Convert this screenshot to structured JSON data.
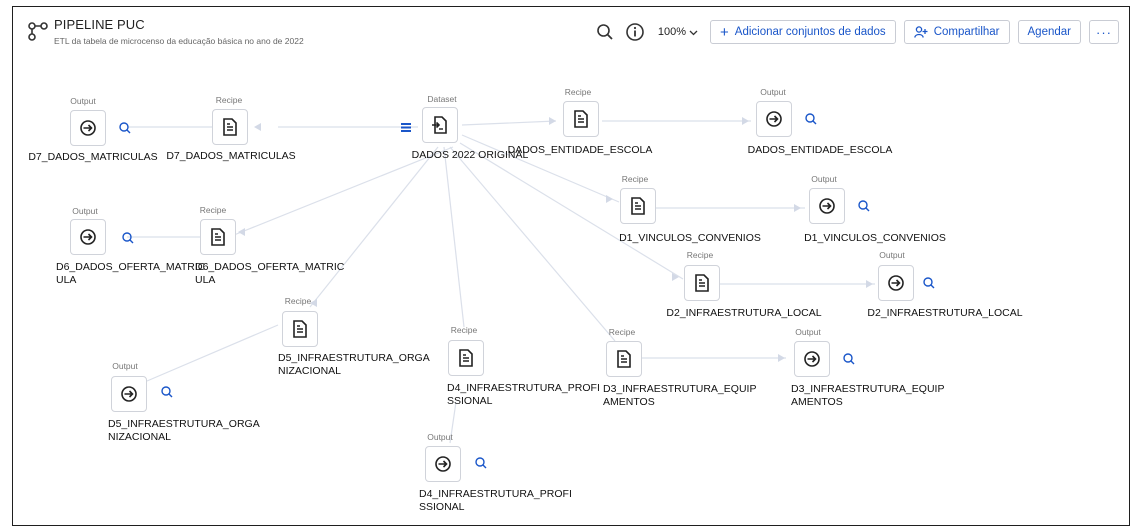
{
  "header": {
    "title": "PIPELINE PUC",
    "subtitle": "ETL da tabela de microcenso da educação básica no ano de 2022",
    "zoom": "100%",
    "add_datasets": "Adicionar conjuntos de dados",
    "share": "Compartilhar",
    "schedule": "Agendar",
    "more": "···"
  },
  "types": {
    "dataset": "Dataset",
    "recipe": "Recipe",
    "output": "Output"
  },
  "nodes": {
    "source": "DADOS 2022 ORIGINAL",
    "d7_recipe": "D7_DADOS_MATRICULAS",
    "d7_output": "D7_DADOS_MATRICULAS",
    "ent_recipe": "DADOS_ENTIDADE_ESCOLA",
    "ent_output": "DADOS_ENTIDADE_ESCOLA",
    "d1_recipe": "D1_VINCULOS_CONVENIOS",
    "d1_output": "D1_VINCULOS_CONVENIOS",
    "d6_output_l1": "D6_DADOS_OFERTA_MATRIC",
    "d6_output_l2": "ULA",
    "d6_recipe_l1": "D6_DADOS_OFERTA_MATRIC",
    "d6_recipe_l2": "ULA",
    "d2_recipe": "D2_INFRAESTRUTURA_LOCAL",
    "d2_output": "D2_INFRAESTRUTURA_LOCAL",
    "d5_recipe_l1": "D5_INFRAESTRUTURA_ORGA",
    "d5_recipe_l2": "NIZACIONAL",
    "d5_output_l1": "D5_INFRAESTRUTURA_ORGA",
    "d5_output_l2": "NIZACIONAL",
    "d4_recipe_l1": "D4_INFRAESTRUTURA_PROFI",
    "d4_recipe_l2": "SSIONAL",
    "d4_output_l1": "D4_INFRAESTRUTURA_PROFI",
    "d4_output_l2": "SSIONAL",
    "d3_recipe_l1": "D3_INFRAESTRUTURA_EQUIP",
    "d3_recipe_l2": "AMENTOS",
    "d3_output_l1": "D3_INFRAESTRUTURA_EQUIP",
    "d3_output_l2": "AMENTOS"
  },
  "colors": {
    "accent": "#1a56c9",
    "edge": "#d3d9e6",
    "node_border": "#d0d3da"
  }
}
